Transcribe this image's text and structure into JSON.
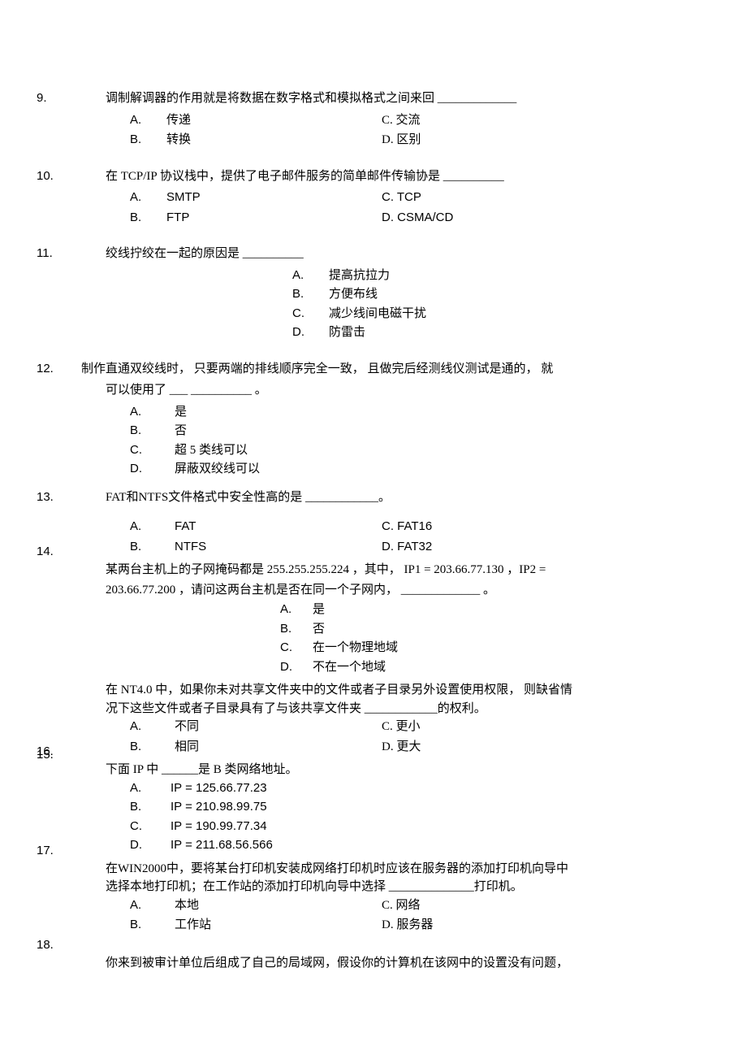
{
  "q9": {
    "num": "9.",
    "stem": "调制解调器的作用就是将数据在数字格式和模拟格式之间来回   _____________",
    "A_lbl": "A.",
    "A": "传递",
    "B_lbl": "B.",
    "B": "转换",
    "C": "C. 交流",
    "D": "D. 区别"
  },
  "q10": {
    "num": "10.",
    "stem": "在  TCP/IP 协议栈中，提供了电子邮件服务的简单邮件传输协是   __________",
    "A_lbl": "A.",
    "A": "SMTP",
    "B_lbl": "B.",
    "B": "FTP",
    "C": "C. TCP",
    "D": "D. CSMA/CD"
  },
  "q11": {
    "num": "11.",
    "stem": "绞线拧绞在一起的原因是   __________",
    "A_lbl": "A.",
    "A": "提高抗拉力",
    "B_lbl": "B.",
    "B": "方便布线",
    "C_lbl": "C.",
    "C": "减少线间电磁干扰",
    "D_lbl": "D.",
    "D": "防雷击"
  },
  "q12": {
    "num": "12.",
    "stem1": "制作直通双绞线时，  只要两端的排线顺序完全一致，  且做完后经测线仪测试是通的，  就",
    "stem2": "可以使用了 ___  __________ 。",
    "A_lbl": "A.",
    "A": "是",
    "B_lbl": "B.",
    "B": "否",
    "C_lbl": "C.",
    "C": "超  5 类线可以",
    "D_lbl": "D.",
    "D": "屏蔽双绞线可以"
  },
  "q13": {
    "num": "13.",
    "stem": "FAT和NTFS文件格式中安全性高的是   ____________。",
    "A_lbl": "A.",
    "A": "FAT",
    "B_lbl": "B.",
    "B": "NTFS",
    "C": "C. FAT16",
    "D": "D. FAT32"
  },
  "q14": {
    "num": "14.",
    "stem1": "某两台主机上的子网掩码都是  255.255.255.224 ，其中，  IP1 = 203.66.77.130 ，IP2 =",
    "stem2": "203.66.77.200 ，请问这两台主机是否在同一个子网内，   _____________  。",
    "A_lbl": "A.",
    "A": "是",
    "B_lbl": "B.",
    "B": "否",
    "C_lbl": "C.",
    "C": "在一个物理地域",
    "D_lbl": "D.",
    "D": "不在一个地域"
  },
  "q15": {
    "num": "15.",
    "stem1": "在  NT4.0 中，如果你未对共享文件夹中的文件或者子目录另外设置使用权限，  则缺省情",
    "stem2": "况下这些文件或者子目录具有了与该共享文件夹  ____________的权利。",
    "A_lbl": "A.",
    "A": "不同",
    "B_lbl": "B.",
    "B": "相同",
    "C": "C. 更小",
    "D": "D. 更大"
  },
  "q16": {
    "num": "16.",
    "stem": "下面  IP 中   ______是  B 类网络地址。",
    "A_lbl": "A.",
    "A": "IP = 125.66.77.23",
    "B_lbl": "B.",
    "B": "IP = 210.98.99.75",
    "C_lbl": "C.",
    "C": "IP = 190.99.77.34",
    "D_lbl": "D.",
    "D": "IP = 211.68.56.566"
  },
  "q17": {
    "num": "17.",
    "stem1": "在WIN2000中，要将某台打印机安装成网络打印机时应该在服务器的添加打印机向导中",
    "stem2": "选择本地打印机；在工作站的添加打印机向导中选择   ______________打印机。",
    "A_lbl": "A.",
    "A": "本地",
    "B_lbl": "B.",
    "B": "工作站",
    "C": "C. 网络",
    "D": "D. 服务器"
  },
  "q18": {
    "num": "18.",
    "text": "你来到被审计单位后组成了自己的局域网，假设你的计算机在该网中的设置没有问题，"
  }
}
